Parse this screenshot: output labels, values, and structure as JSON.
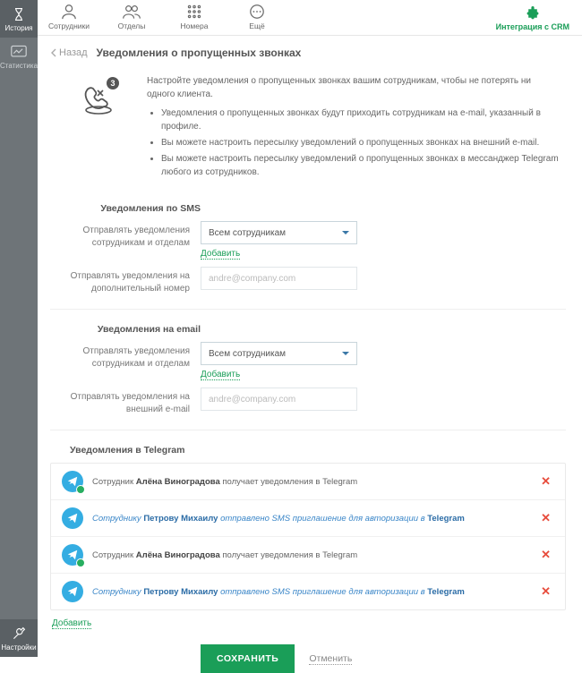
{
  "leftbar": {
    "items": [
      {
        "label": "История"
      },
      {
        "label": "Статистика"
      },
      {
        "label": "Настройки"
      }
    ]
  },
  "topnav": {
    "items": [
      {
        "label": "Сотрудники"
      },
      {
        "label": "Отделы"
      },
      {
        "label": "Номера"
      },
      {
        "label": "Ещё"
      }
    ],
    "crm": "Интеграция с CRM"
  },
  "crumb": {
    "back": "Назад",
    "title": "Уведомления о пропущенных звонках"
  },
  "intro": {
    "lead": "Настройте уведомления о пропущенных звонках вашим сотрудникам, чтобы не потерять ни одного клиента.",
    "bullets": [
      "Уведомления о пропущенных звонках будут приходить сотрудникам на e-mail, указанный в профиле.",
      "Вы можете настроить пересылку уведомлений о пропущенных звонках на внешний e-mail.",
      "Вы можете настроить пересылку уведомлений о пропущенных звонках в мессанджер Telegram любого из сотрудников."
    ]
  },
  "sms": {
    "title": "Уведомления по SMS",
    "dept_label": "Отправлять уведомления сотрудникам и отделам",
    "dept_value": "Всем сотрудникам",
    "add": "Добавить",
    "extra_label": "Отправлять уведомления на дополнительный номер",
    "extra_placeholder": "andre@company.com"
  },
  "email": {
    "title": "Уведомления на email",
    "dept_label": "Отправлять уведомления сотрудникам и отделам",
    "dept_value": "Всем сотрудникам",
    "add": "Добавить",
    "extra_label": "Отправлять уведомления на внешний e-mail",
    "extra_placeholder": "andre@company.com"
  },
  "telegram": {
    "title": "Уведомления в Telegram",
    "rows": [
      {
        "status": "ok",
        "pre": "Сотрудник ",
        "name": "Алёна Виноградова",
        "post": " получает уведомления в Telegram"
      },
      {
        "status": "pending",
        "pre": "Сотруднику ",
        "name": "Петрову Михаилу",
        "post": " отправлено SMS приглашение для авторизации в ",
        "suffix_bold": "Telegram"
      },
      {
        "status": "ok",
        "pre": "Сотрудник ",
        "name": "Алёна Виноградова",
        "post": " получает уведомления в Telegram"
      },
      {
        "status": "pending",
        "pre": "Сотруднику ",
        "name": "Петрову Михаилу",
        "post": " отправлено SMS приглашение для авторизации в ",
        "suffix_bold": "Telegram"
      }
    ],
    "add": "Добавить"
  },
  "footer": {
    "save": "СОХРАНИТЬ",
    "cancel": "Отменить"
  }
}
